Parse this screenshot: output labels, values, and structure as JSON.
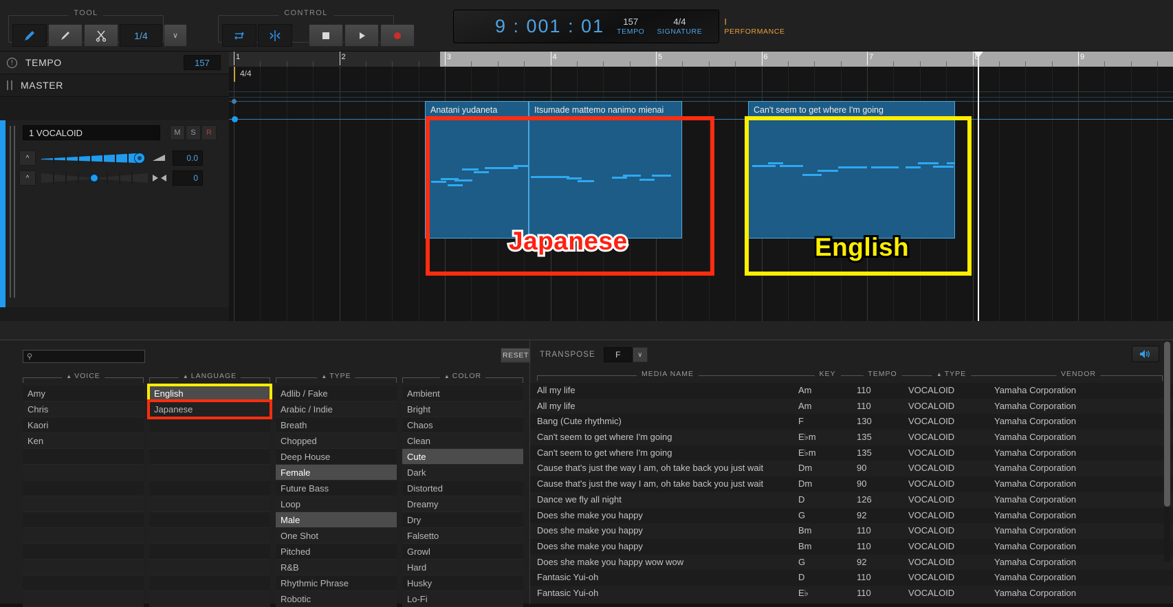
{
  "toolbar": {
    "tool_group_label": "TOOL",
    "control_group_label": "CONTROL",
    "tools": [
      {
        "name": "pencil-tool",
        "icon": "pencil-icon",
        "active": true
      },
      {
        "name": "line-tool",
        "icon": "line-icon",
        "active": false
      },
      {
        "name": "scissors-tool",
        "icon": "scissors-icon",
        "active": false
      }
    ],
    "quantize_value": "1/4",
    "quantize_chevron": "∨",
    "controls": [
      {
        "name": "loop-button",
        "icon": "loop-icon"
      },
      {
        "name": "snap-button",
        "icon": "snap-icon"
      }
    ],
    "transport": [
      {
        "name": "stop-button",
        "icon": "stop-icon"
      },
      {
        "name": "play-button",
        "icon": "play-icon"
      },
      {
        "name": "record-button",
        "icon": "record-icon"
      }
    ]
  },
  "display": {
    "position": "9 : 001 : 01",
    "tempo_value": "157",
    "tempo_label": "TEMPO",
    "signature_value": "4/4",
    "signature_label": "SIGNATURE",
    "performance_value": "I",
    "performance_label": "PERFORMANCE"
  },
  "left_panel": {
    "tempo_label": "TEMPO",
    "tempo_value": "157",
    "master_label": "MASTER",
    "track": {
      "name": "1 VOCALOID",
      "mute_label": "M",
      "solo_label": "S",
      "rec_label": "R",
      "volume_value": "0.0",
      "pan_value": "0"
    }
  },
  "timeline": {
    "signature_marker": "4/4",
    "bar_labels": [
      "1",
      "2",
      "3",
      "4",
      "5",
      "6",
      "7",
      "8",
      "9"
    ],
    "playhead_bar": "9",
    "clips": [
      {
        "name": "clip-japanese-1",
        "title": "Anatani yudaneta"
      },
      {
        "name": "clip-japanese-2",
        "title": "Itsumade mattemo nanimo mienai"
      },
      {
        "name": "clip-english-1",
        "title": "Can't seem to get where I'm going"
      }
    ],
    "annotations": [
      {
        "name": "annotation-japanese",
        "label": "Japanese",
        "color": "#ff2010",
        "stroke": "#ffffff"
      },
      {
        "name": "annotation-english",
        "label": "English",
        "color": "#ffee00",
        "stroke": "#000000"
      }
    ]
  },
  "browser": {
    "search_placeholder": "",
    "search_value": "",
    "search_icon": "search-icon",
    "reset_label": "RESET",
    "filters": [
      {
        "name": "voice",
        "label": "VOICE",
        "sort_arrow": "▲",
        "items": [
          "Amy",
          "Chris",
          "Kaori",
          "Ken"
        ]
      },
      {
        "name": "language",
        "label": "LANGUAGE",
        "sort_arrow": "▲",
        "items": [
          "English",
          "Japanese"
        ],
        "selected": [
          "English"
        ],
        "highlight_english": "#ffee00",
        "highlight_japanese": "#ff2d10"
      },
      {
        "name": "type",
        "label": "TYPE",
        "sort_arrow": "▲",
        "items": [
          "Adlib / Fake",
          "Arabic / Indie",
          "Breath",
          "Chopped",
          "Deep House",
          "Female",
          "Future Bass",
          "Loop",
          "Male",
          "One Shot",
          "Pitched",
          "R&B",
          "Rhythmic Phrase",
          "Robotic"
        ],
        "selected": [
          "Female",
          "Male"
        ]
      },
      {
        "name": "color",
        "label": "COLOR",
        "sort_arrow": "▲",
        "items": [
          "Ambient",
          "Bright",
          "Chaos",
          "Clean",
          "Cute",
          "Dark",
          "Distorted",
          "Dreamy",
          "Dry",
          "Falsetto",
          "Growl",
          "Hard",
          "Husky",
          "Lo-Fi"
        ],
        "selected": [
          "Cute"
        ]
      }
    ],
    "transpose_label": "TRANSPOSE",
    "transpose_value": "F",
    "transpose_chevron": "∨",
    "speaker_icon": "speaker-icon",
    "media_columns": [
      {
        "name": "media-name",
        "label": "MEDIA NAME",
        "sorted": false
      },
      {
        "name": "key",
        "label": "KEY",
        "sorted": false
      },
      {
        "name": "tempo",
        "label": "TEMPO",
        "sorted": false
      },
      {
        "name": "type",
        "label": "TYPE",
        "sorted": true,
        "sort_arrow": "▲"
      },
      {
        "name": "vendor",
        "label": "VENDOR",
        "sorted": false
      }
    ],
    "media_rows": [
      {
        "media_name": "All my life",
        "key": "Am",
        "tempo": "110",
        "type": "VOCALOID",
        "vendor": "Yamaha Corporation"
      },
      {
        "media_name": "All my life",
        "key": "Am",
        "tempo": "110",
        "type": "VOCALOID",
        "vendor": "Yamaha Corporation"
      },
      {
        "media_name": "Bang (Cute rhythmic)",
        "key": "F",
        "tempo": "130",
        "type": "VOCALOID",
        "vendor": "Yamaha Corporation"
      },
      {
        "media_name": "Can't seem to get where I'm going",
        "key": "E♭m",
        "tempo": "135",
        "type": "VOCALOID",
        "vendor": "Yamaha Corporation"
      },
      {
        "media_name": "Can't seem to get where I'm going",
        "key": "E♭m",
        "tempo": "135",
        "type": "VOCALOID",
        "vendor": "Yamaha Corporation"
      },
      {
        "media_name": "Cause that's just the way I am, oh take back you just wait",
        "key": "Dm",
        "tempo": "90",
        "type": "VOCALOID",
        "vendor": "Yamaha Corporation"
      },
      {
        "media_name": "Cause that's just the way I am, oh take back you just wait",
        "key": "Dm",
        "tempo": "90",
        "type": "VOCALOID",
        "vendor": "Yamaha Corporation"
      },
      {
        "media_name": "Dance we fly all night",
        "key": "D",
        "tempo": "126",
        "type": "VOCALOID",
        "vendor": "Yamaha Corporation"
      },
      {
        "media_name": "Does she make you happy",
        "key": "G",
        "tempo": "92",
        "type": "VOCALOID",
        "vendor": "Yamaha Corporation"
      },
      {
        "media_name": "Does she make you happy",
        "key": "Bm",
        "tempo": "110",
        "type": "VOCALOID",
        "vendor": "Yamaha Corporation"
      },
      {
        "media_name": "Does she make you happy",
        "key": "Bm",
        "tempo": "110",
        "type": "VOCALOID",
        "vendor": "Yamaha Corporation"
      },
      {
        "media_name": "Does she make you happy wow wow",
        "key": "G",
        "tempo": "92",
        "type": "VOCALOID",
        "vendor": "Yamaha Corporation"
      },
      {
        "media_name": "Fantasic Yui-oh",
        "key": "D",
        "tempo": "110",
        "type": "VOCALOID",
        "vendor": "Yamaha Corporation"
      },
      {
        "media_name": "Fantasic Yui-oh",
        "key": "E♭",
        "tempo": "110",
        "type": "VOCALOID",
        "vendor": "Yamaha Corporation"
      }
    ]
  }
}
